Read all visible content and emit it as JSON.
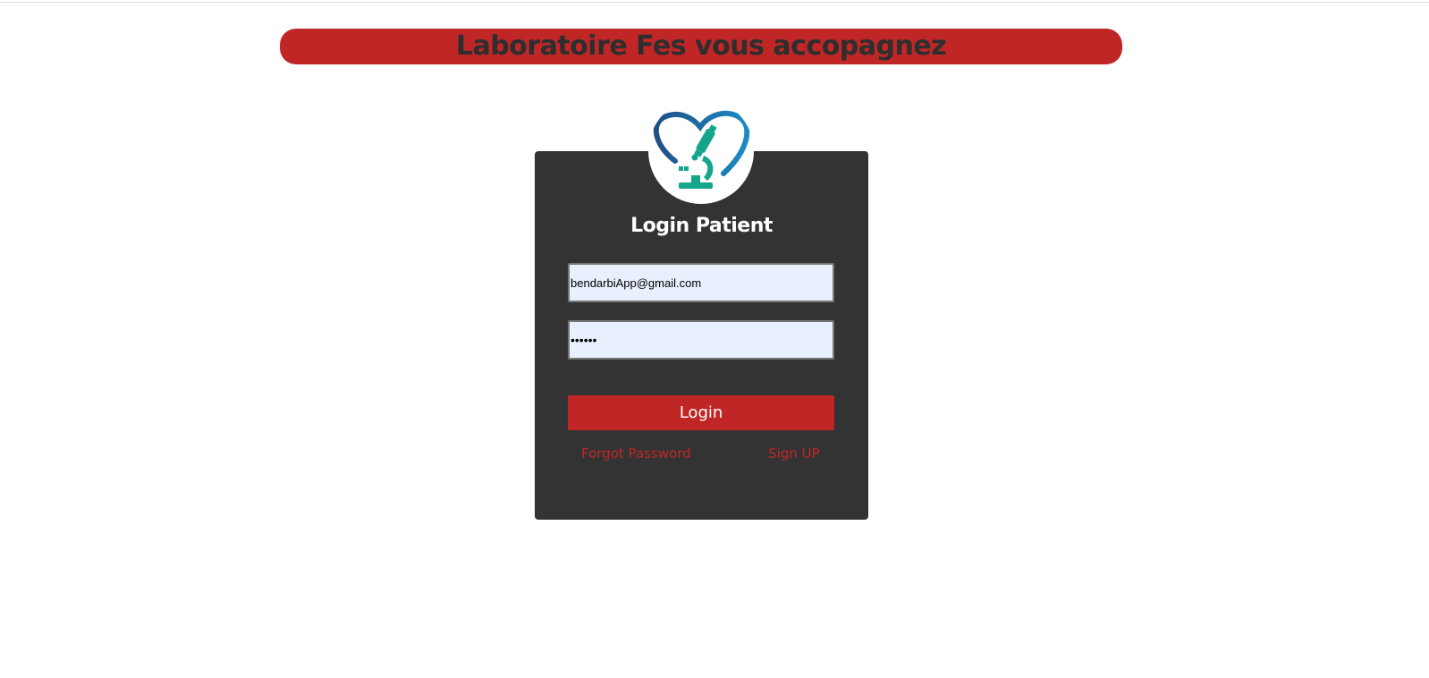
{
  "header": {
    "title": "Laboratoire Fes vous accopagnez",
    "background_color": "#c02626"
  },
  "login_card": {
    "title": "Login Patient",
    "logo": "heart-microscope-logo",
    "email": {
      "value": "bendarbiApp@gmail.com"
    },
    "password": {
      "value": "••••••"
    },
    "login_label": "Login",
    "forgot_password_label": "Forgot Password",
    "sign_up_label": "Sign UP"
  },
  "colors": {
    "accent": "#c02626",
    "card_background": "#333333",
    "input_background": "#e8f0fe",
    "logo_heart_blue": "#1a6fa6",
    "logo_microscope_teal": "#14a58a"
  }
}
